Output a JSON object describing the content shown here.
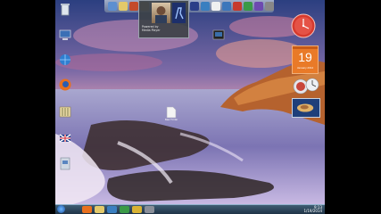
{
  "media_widget": {
    "line1": "Powered by",
    "line2": "Media Player"
  },
  "calendar": {
    "day": "19",
    "month": "January 2014"
  },
  "taskbar": {
    "clock_time": "9:13",
    "clock_date": "1/19/2014"
  },
  "desktop": {
    "file_label": "New Folder"
  },
  "icons": {
    "desktop": [
      "recycle-bin-icon",
      "computer-icon",
      "network-icon",
      "firefox-icon",
      "folder-icon",
      "flag-icon",
      "program-icon"
    ],
    "dock": [
      "explorer-icon",
      "folder-icon",
      "warcraft-icon",
      "photo-icon",
      "counter-strike-icon",
      "app-icon",
      "browser-icon",
      "media-icon",
      "app-icon",
      "app-icon",
      "app-icon",
      "app-icon"
    ],
    "taskbar": [
      "start-orb-icon",
      "firefox-icon",
      "explorer-icon",
      "media-player-icon",
      "messenger-icon",
      "chrome-icon",
      "app-icon"
    ]
  },
  "colors": {
    "taskbar": "#2a4257",
    "calendar": "#e97a28",
    "dock": "#a9b4c6"
  }
}
